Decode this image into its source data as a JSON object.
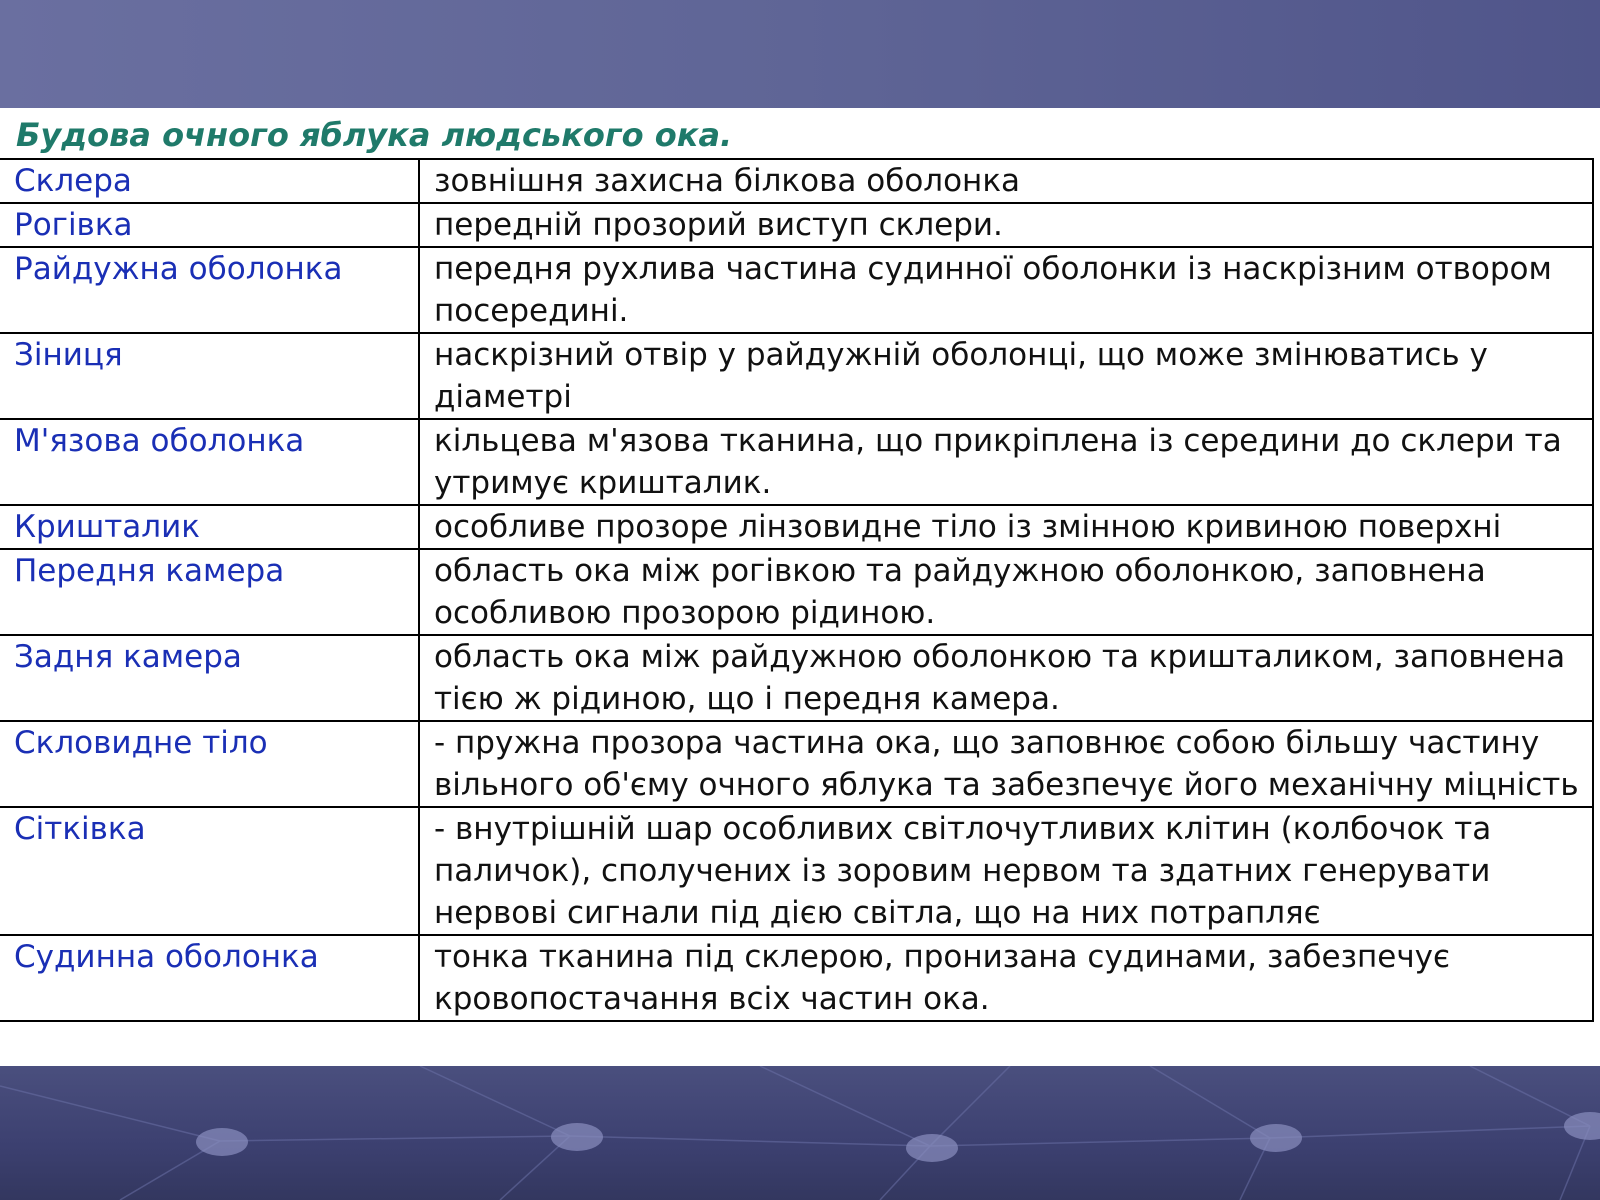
{
  "slide": {
    "title": "Будова очного яблука людського ока.",
    "colors": {
      "background": "#5a5f93",
      "title": "#1f7a6a",
      "term": "#1a2fb5",
      "definition": "#111111"
    },
    "rows": [
      {
        "term": "Склера",
        "definition": "зовнішня захисна білкова оболонка"
      },
      {
        "term": "Рогівка",
        "definition": "передній прозорий виступ склери."
      },
      {
        "term": "Райдужна оболонка",
        "definition": "передня рухлива частина судинної оболонки із наскрізним отвором посередині."
      },
      {
        "term": "Зіниця",
        "definition": "наскрізний отвір у райдужній оболонці, що може змінюватись у діаметрі"
      },
      {
        "term": "М'язова оболонка",
        "definition": "кільцева м'язова тканина, що прикріплена із середини до склери та утримує кришталик."
      },
      {
        "term": "Кришталик",
        "definition": "особливе прозоре лінзовидне тіло із змінною кривиною поверхні"
      },
      {
        "term": "Передня камера",
        "definition": "область ока між рогівкою та райдужною оболонкою, заповнена особливою прозорою рідиною."
      },
      {
        "term": "Задня камера",
        "definition": "область ока між райдужною оболонкою та кришталиком, заповнена тією ж рідиною, що і передня камера."
      },
      {
        "term": "Скловидне тіло",
        "definition": "- пружна прозора частина ока, що заповнює собою більшу частину вільного об'єму очного яблука та забезпечує його механічну міцність"
      },
      {
        "term": "Сітківка",
        "definition": "- внутрішній шар особливих світлочутливих клітин (колбочок та паличок), сполучених із зоровим нервом та здатних генерувати нервові сигнали під дією світла, що на них потрапляє"
      },
      {
        "term": "Судинна оболонка",
        "definition": "тонка тканина під склерою, пронизана судинами, забезпечує кровопостачання всіх частин ока."
      }
    ]
  }
}
